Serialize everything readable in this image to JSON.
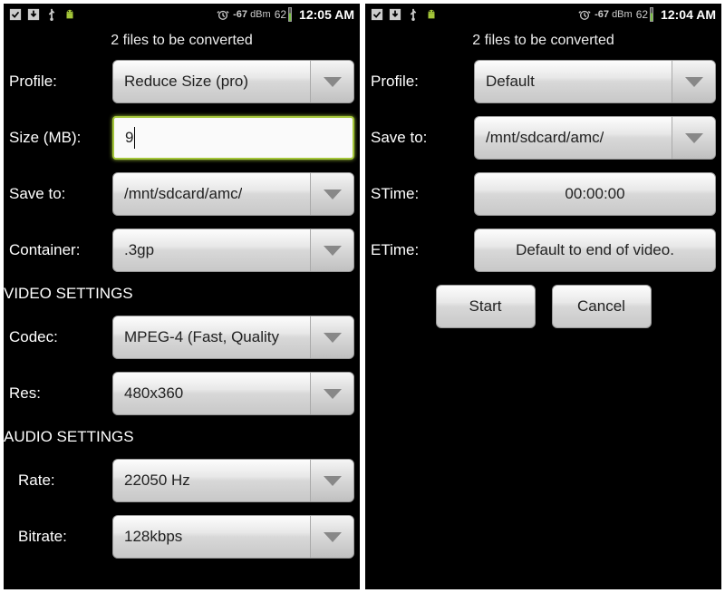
{
  "left": {
    "status": {
      "signal": "-67",
      "signalUnit": "dBm",
      "battery": "62",
      "time": "12:05 AM"
    },
    "subheader": "2  files to be converted",
    "labels": {
      "profile": "Profile:",
      "size": "Size (MB):",
      "saveto": "Save to:",
      "container": "Container:",
      "videoSection": "VIDEO SETTINGS",
      "codec": "Codec:",
      "res": "Res:",
      "audioSection": "AUDIO SETTINGS",
      "rate": "Rate:",
      "bitrate": "Bitrate:"
    },
    "values": {
      "profile": "Reduce Size (pro)",
      "size": "9",
      "saveto": "/mnt/sdcard/amc/",
      "container": ".3gp",
      "codec": "MPEG-4 (Fast, Quality",
      "res": "480x360",
      "rate": "22050 Hz",
      "bitrate": "128kbps"
    }
  },
  "right": {
    "status": {
      "signal": "-67",
      "signalUnit": "dBm",
      "battery": "62",
      "time": "12:04 AM"
    },
    "subheader": "2  files to be converted",
    "labels": {
      "profile": "Profile:",
      "saveto": "Save to:",
      "stime": "STime:",
      "etime": "ETime:"
    },
    "values": {
      "profile": "Default",
      "saveto": "/mnt/sdcard/amc/",
      "stime": "00:00:00",
      "etime": "Default to end of video."
    },
    "buttons": {
      "start": "Start",
      "cancel": "Cancel"
    }
  }
}
